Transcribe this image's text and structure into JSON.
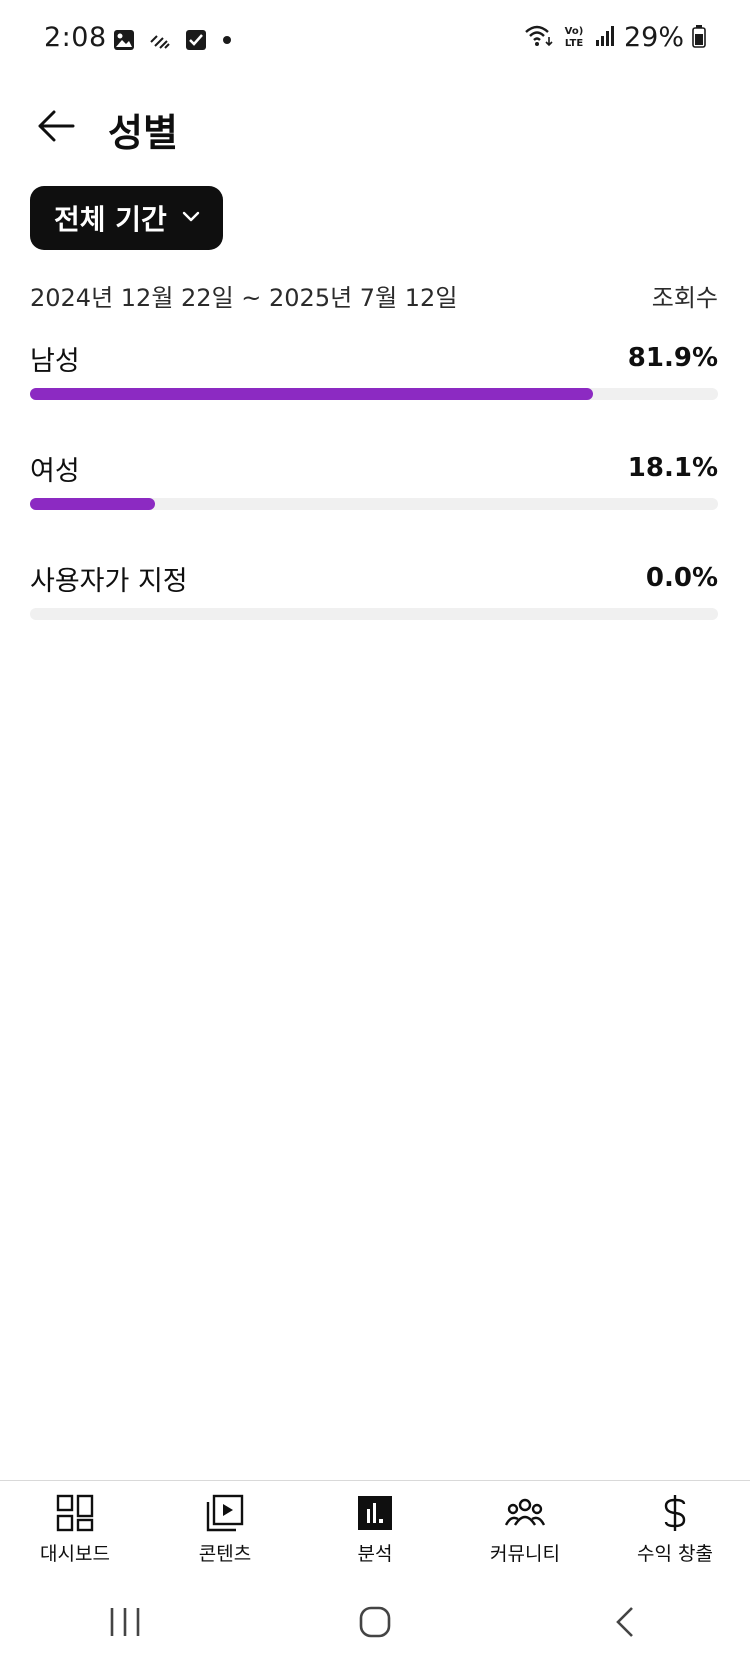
{
  "status_bar": {
    "time": "2:08",
    "battery": "29%",
    "left_icons": [
      "gallery-icon",
      "signal-waves-icon",
      "checkbox-icon",
      "dot-icon"
    ],
    "right_icons": [
      "wifi-icon",
      "volte-icon",
      "cell-signal-icon",
      "battery-icon"
    ]
  },
  "header": {
    "title": "성별",
    "back_icon": "arrow-left-icon"
  },
  "period": {
    "label": "전체 기간",
    "icon": "chevron-down-icon"
  },
  "range": {
    "dates": "2024년 12월 22일 ~ 2025년 7월 12일",
    "metric": "조회수"
  },
  "genders": [
    {
      "label": "남성",
      "value": "81.9%",
      "fraction": 0.819
    },
    {
      "label": "여성",
      "value": "18.1%",
      "fraction": 0.181
    },
    {
      "label": "사용자가 지정",
      "value": "0.0%",
      "fraction": 0.0
    }
  ],
  "bottom_nav": [
    {
      "label": "대시보드",
      "icon": "dashboard-icon"
    },
    {
      "label": "콘텐츠",
      "icon": "content-icon"
    },
    {
      "label": "분석",
      "icon": "analytics-icon",
      "active": true
    },
    {
      "label": "커뮤니티",
      "icon": "community-icon"
    },
    {
      "label": "수익 창출",
      "icon": "dollar-icon"
    }
  ],
  "colors": {
    "bar_fill": "#8c2ac2",
    "bar_track": "#f0f0f0",
    "dropdown_bg": "#0f0f0f"
  }
}
